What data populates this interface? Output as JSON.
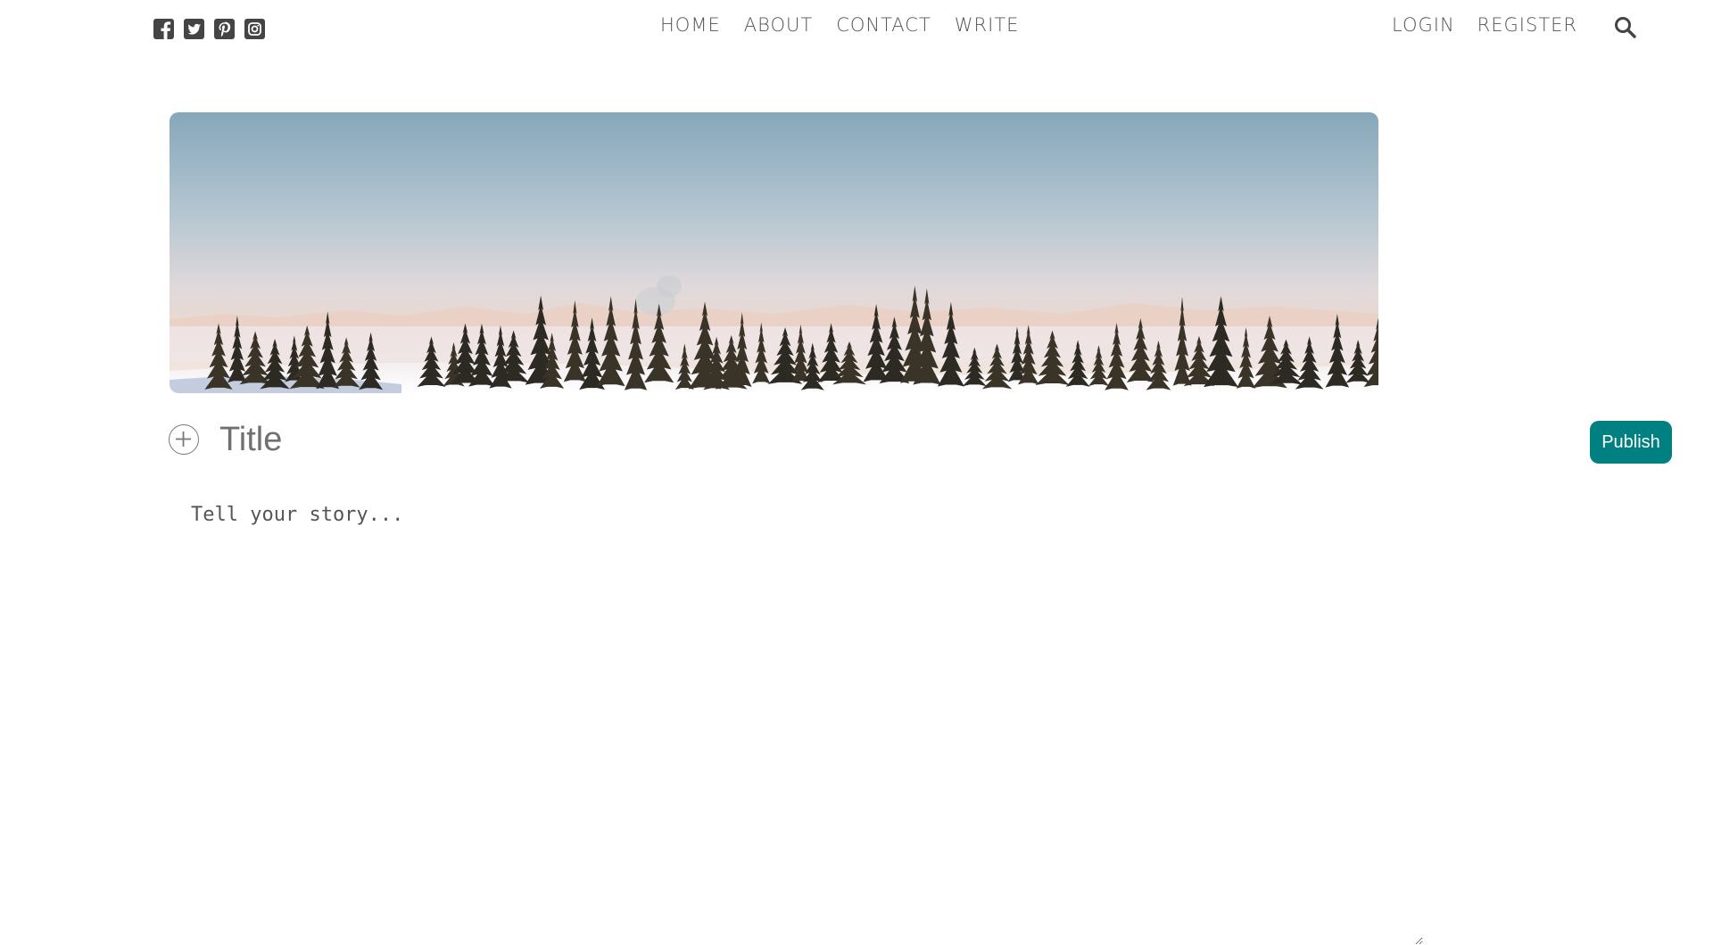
{
  "social": [
    {
      "name": "facebook",
      "icon": "facebook-icon"
    },
    {
      "name": "twitter",
      "icon": "twitter-icon"
    },
    {
      "name": "pinterest",
      "icon": "pinterest-icon"
    },
    {
      "name": "instagram",
      "icon": "instagram-icon"
    }
  ],
  "nav": {
    "home": "HOME",
    "about": "ABOUT",
    "contact": "CONTACT",
    "write": "WRITE"
  },
  "auth": {
    "login": "LOGIN",
    "register": "REGISTER"
  },
  "search": {
    "icon": "search-icon"
  },
  "cover": {
    "description_icon": "cover-image"
  },
  "editor": {
    "title_placeholder": "Title",
    "title_value": "",
    "story_placeholder": "Tell your story...",
    "story_value": "",
    "publish_label": "Publish"
  },
  "colors": {
    "accent": "#008080",
    "text": "#444444"
  }
}
